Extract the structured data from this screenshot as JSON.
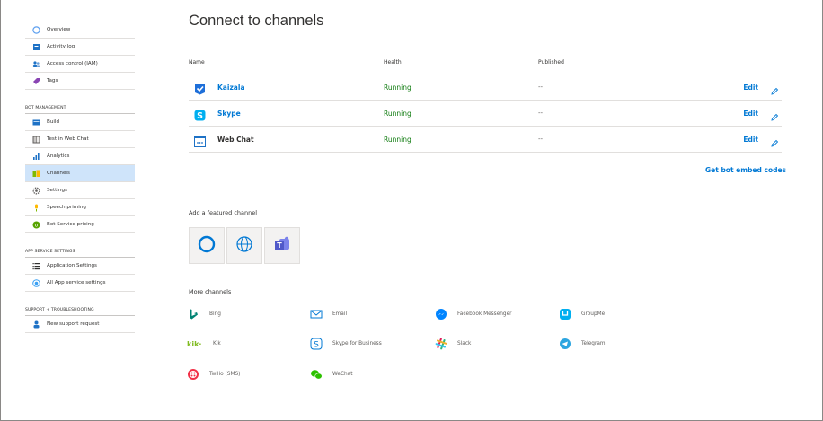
{
  "sidebar": {
    "items_top": [
      {
        "label": "Overview"
      },
      {
        "label": "Activity log"
      },
      {
        "label": "Access control (IAM)"
      },
      {
        "label": "Tags"
      }
    ],
    "section_bot": "BOT MANAGEMENT",
    "items_bot": [
      {
        "label": "Build"
      },
      {
        "label": "Test in Web Chat"
      },
      {
        "label": "Analytics"
      },
      {
        "label": "Channels"
      },
      {
        "label": "Settings"
      },
      {
        "label": "Speech priming"
      },
      {
        "label": "Bot Service pricing"
      }
    ],
    "section_app": "APP SERVICE SETTINGS",
    "items_app": [
      {
        "label": "Application Settings"
      },
      {
        "label": "All App service settings"
      }
    ],
    "section_support": "SUPPORT + TROUBLESHOOTING",
    "items_support": [
      {
        "label": "New support request"
      }
    ]
  },
  "main": {
    "title": "Connect to channels",
    "columns": {
      "name": "Name",
      "health": "Health",
      "published": "Published"
    },
    "channels": [
      {
        "name": "Kaizala",
        "health": "Running",
        "published": "--",
        "edit": "Edit"
      },
      {
        "name": "Skype",
        "health": "Running",
        "published": "--",
        "edit": "Edit"
      },
      {
        "name": "Web Chat",
        "health": "Running",
        "published": "--",
        "edit": "Edit"
      }
    ],
    "embed_link": "Get bot embed codes",
    "featured_head": "Add a featured channel",
    "more_head": "More channels",
    "more_channels": [
      {
        "label": "Bing"
      },
      {
        "label": "Email"
      },
      {
        "label": "Facebook Messenger"
      },
      {
        "label": "GroupMe"
      },
      {
        "label": "Kik"
      },
      {
        "label": "Skype for Business"
      },
      {
        "label": "Slack"
      },
      {
        "label": "Telegram"
      },
      {
        "label": "Twilio (SMS)"
      },
      {
        "label": "WeChat"
      }
    ]
  },
  "colors": {
    "link": "#0078d4",
    "running": "#107c10",
    "active_nav": "#cfe4fa"
  }
}
